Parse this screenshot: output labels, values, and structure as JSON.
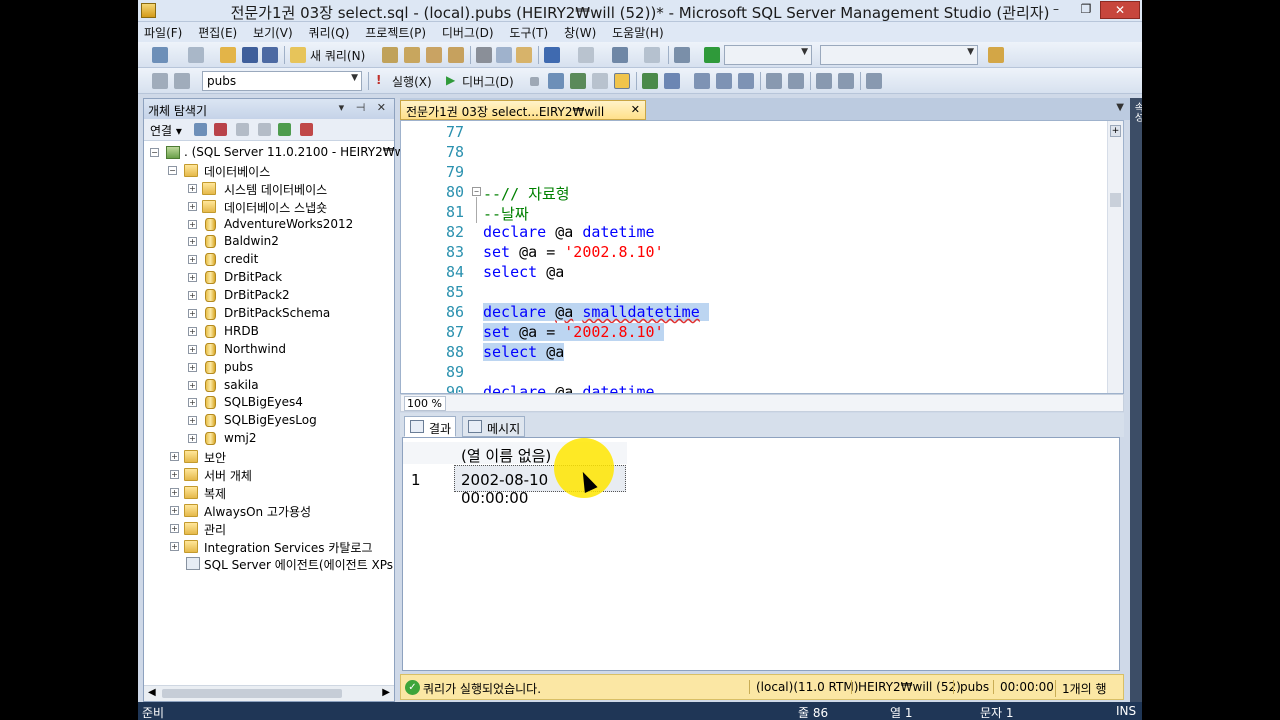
{
  "titlebar": {
    "title": "전문가1권 03장 select.sql - (local).pubs (HEIRY2₩will (52))* - Microsoft SQL Server Management Studio (관리자)",
    "min": "–",
    "max": "❐",
    "close": "✕"
  },
  "menu": [
    "파일(F)",
    "편집(E)",
    "보기(V)",
    "쿼리(Q)",
    "프로젝트(P)",
    "디버그(D)",
    "도구(T)",
    "창(W)",
    "도움말(H)"
  ],
  "toolbar1": {
    "new_query": "새 쿼리(N)"
  },
  "toolbar2": {
    "database": "pubs",
    "execute": "실행(X)",
    "debug": "디버그(D)"
  },
  "object_explorer": {
    "title": "개체 탐색기",
    "pin": "▾ ⊣ ✕",
    "connect": "연결 ▾",
    "server": ". (SQL Server 11.0.2100 - HEIRY2₩will",
    "databases_folder": "데이터베이스",
    "system_items": [
      "시스템 데이터베이스",
      "데이터베이스 스냅숏"
    ],
    "databases": [
      "AdventureWorks2012",
      "Baldwin2",
      "credit",
      "DrBitPack",
      "DrBitPack2",
      "DrBitPackSchema",
      "HRDB",
      "Northwind",
      "pubs",
      "sakila",
      "SQLBigEyes4",
      "SQLBigEyesLog",
      "wmj2"
    ],
    "folders": [
      "보안",
      "서버 개체",
      "복제",
      "AlwaysOn 고가용성",
      "관리",
      "Integration Services 카탈로그"
    ],
    "agent": "SQL Server 에이전트(에이전트 XPs"
  },
  "doc_tab": {
    "label": "전문가1권 03장 select...EIRY2₩will (52))*",
    "close": "✕"
  },
  "editor": {
    "line_numbers": [
      "77",
      "78",
      "79",
      "80",
      "81",
      "82",
      "83",
      "84",
      "85",
      "86",
      "87",
      "88",
      "89",
      "90"
    ],
    "l80": "--// 자료형",
    "l81": "--날짜",
    "kw_declare": "declare",
    "kw_set": "set",
    "kw_select": "select",
    "var": "@a",
    "type_datetime": "datetime",
    "type_smalldatetime": "smalldatetime",
    "eq": " = ",
    "str_date": "'2002.8.10'",
    "zoom": "100 %"
  },
  "results": {
    "tab_results": "결과",
    "tab_messages": "메시지",
    "column_header": "(열 이름 없음)",
    "row_number": "1",
    "cell_value": "2002-08-10 00:00:00"
  },
  "query_status": {
    "message": "쿼리가 실행되었습니다.",
    "server": "(local)(11.0 RTM)",
    "user": "HEIRY2₩will (52)",
    "db": "pubs",
    "time": "00:00:00",
    "rows": "1개의 행"
  },
  "statusbar": {
    "ready": "준비",
    "line": "줄 86",
    "col": "열 1",
    "ch": "문자 1",
    "ins": "INS"
  },
  "right_panel": "속성"
}
